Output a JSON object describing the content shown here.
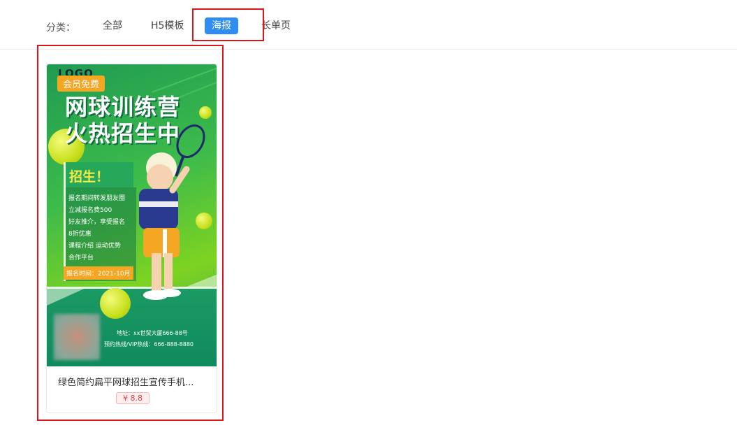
{
  "filter": {
    "label": "分类：",
    "categories": [
      "全部",
      "H5模板",
      "海报",
      "长单页"
    ],
    "active": "海报"
  },
  "card": {
    "title": "绿色简约扁平网球招生宣传手机...",
    "price": "¥ 8.8",
    "poster": {
      "logo": "LOGO",
      "badge": "会员免费",
      "headline_1": "网球训练营",
      "headline_2": "火热招生中",
      "recruit": "招生！",
      "info": [
        "报名期间转发朋友圈",
        "立减报名费500",
        "好友推介，享受报名",
        "8折优惠",
        "课程介绍 运动优势",
        "合作平台"
      ],
      "date": "报名时间：2021-10月",
      "address": "地址：xx世贸大厦666-88号",
      "hotline": "预约热线/VIP热线：666-888-8880"
    }
  },
  "colors": {
    "active_tab": "#2f8cf0",
    "highlight_border": "#e0151b",
    "price": "#e6414a",
    "badge": "#f5a623"
  }
}
